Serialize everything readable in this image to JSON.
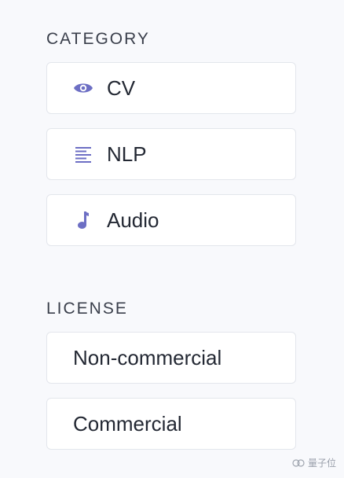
{
  "category": {
    "title": "CATEGORY",
    "items": [
      {
        "label": "CV",
        "icon": "eye-icon"
      },
      {
        "label": "NLP",
        "icon": "text-lines-icon"
      },
      {
        "label": "Audio",
        "icon": "music-note-icon"
      }
    ]
  },
  "license": {
    "title": "LICENSE",
    "items": [
      {
        "label": "Non-commercial"
      },
      {
        "label": "Commercial"
      }
    ]
  },
  "watermark": {
    "text": "量子位"
  },
  "colors": {
    "icon_accent": "#6d6fc4",
    "background": "#f8f9fc",
    "button_border": "#e3e6ec"
  }
}
